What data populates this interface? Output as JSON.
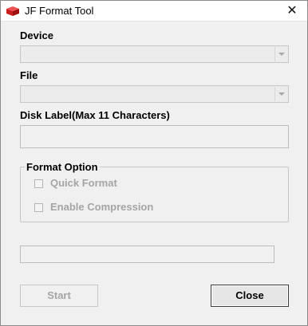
{
  "window": {
    "title": "JF Format Tool",
    "app_icon": "red-cube-icon",
    "close_glyph": "✕"
  },
  "form": {
    "device_label": "Device",
    "file_label": "File",
    "disk_label_label": "Disk Label(Max 11 Characters)",
    "device_value": "",
    "file_value": "",
    "disk_label_value": ""
  },
  "format_option": {
    "title": "Format Option",
    "quick_format_label": "Quick Format",
    "quick_format_checked": false,
    "enable_compression_label": "Enable Compression",
    "enable_compression_checked": false
  },
  "progress": {
    "value": 0
  },
  "buttons": {
    "start_label": "Start",
    "close_label": "Close"
  }
}
